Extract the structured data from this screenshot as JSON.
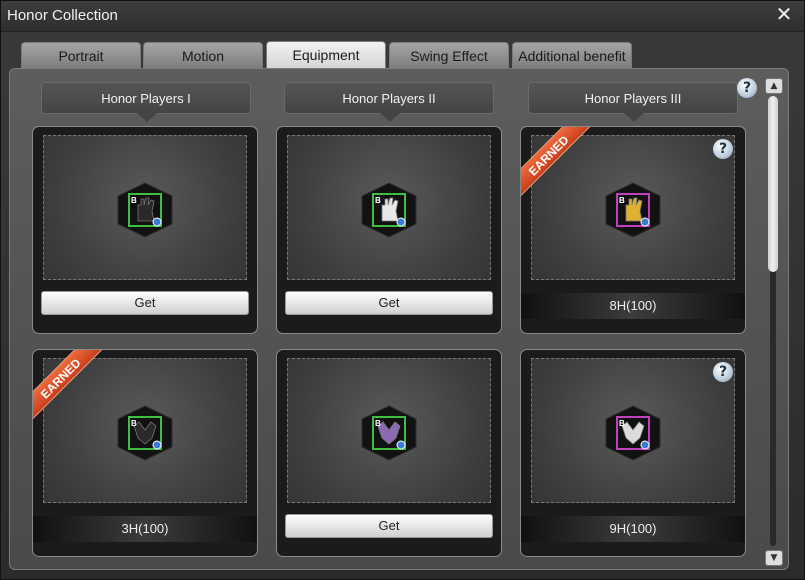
{
  "window": {
    "title": "Honor Collection",
    "close_icon": "close-icon"
  },
  "tabs": [
    {
      "label": "Portrait",
      "active": false
    },
    {
      "label": "Motion",
      "active": false
    },
    {
      "label": "Equipment",
      "active": true
    },
    {
      "label": "Swing Effect",
      "active": false
    },
    {
      "label": "Additional benefit",
      "active": false
    }
  ],
  "columns": [
    {
      "header": "Honor Players I"
    },
    {
      "header": "Honor Players II"
    },
    {
      "header": "Honor Players III"
    }
  ],
  "help_label": "?",
  "cards": [
    {
      "item_icon": "black-glove-icon",
      "icon_color": "#2a2a2a",
      "frame_color": "#3fbf3f",
      "earned": false,
      "button": "Get"
    },
    {
      "item_icon": "white-glove-icon",
      "icon_color": "#e8e8e8",
      "frame_color": "#3fbf3f",
      "earned": false,
      "button": "Get"
    },
    {
      "item_icon": "gold-glove-icon",
      "icon_color": "#e0b030",
      "frame_color": "#c040c0",
      "earned": true,
      "ribbon": "EARNED",
      "status": "8H(100)"
    },
    {
      "item_icon": "black-shoes-icon",
      "icon_color": "#2a2a2a",
      "frame_color": "#3fbf3f",
      "earned": true,
      "ribbon": "EARNED",
      "status": "3H(100)"
    },
    {
      "item_icon": "purple-shoes-icon",
      "icon_color": "#8a6ab0",
      "frame_color": "#3fbf3f",
      "earned": false,
      "button": "Get"
    },
    {
      "item_icon": "white-shoes-icon",
      "icon_color": "#dcdcdc",
      "frame_color": "#c040c0",
      "earned": false,
      "status": "9H(100)"
    }
  ],
  "scrollbar": {
    "up_icon": "▲",
    "down_icon": "▼"
  }
}
